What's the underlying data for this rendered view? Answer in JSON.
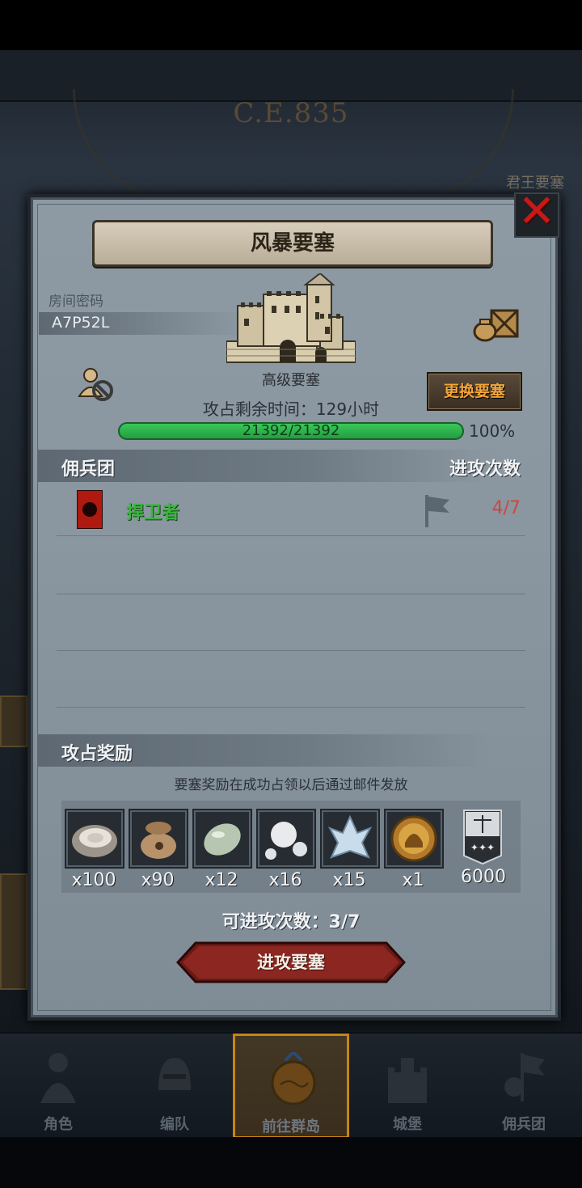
{
  "background": {
    "era_text": "C.E.835",
    "right_title": "君王要塞"
  },
  "dialog": {
    "title": "风暴要塞",
    "room_password_label": "房间密码",
    "room_password": "A7P52L",
    "fortress_type": "高级要塞",
    "time_left": "攻占剩余时间：129小时",
    "change_button": "更换要塞",
    "hp_text": "21392/21392",
    "hp_percent_text": "100%",
    "hp_fraction": 1.0,
    "mercenary_header": "佣兵团",
    "attacks_header": "进攻次数",
    "mercenaries": [
      {
        "name": "捍卫者",
        "attacks": "4/7"
      }
    ],
    "rewards_header": "攻占奖励",
    "rewards_note": "要塞奖励在成功占领以后通过邮件发放",
    "rewards": [
      {
        "icon": "oyster-icon",
        "qty": "x100"
      },
      {
        "icon": "sack-icon",
        "qty": "x90"
      },
      {
        "icon": "jade-stone-icon",
        "qty": "x12"
      },
      {
        "icon": "pearls-icon",
        "qty": "x16"
      },
      {
        "icon": "ice-crystal-icon",
        "qty": "x15"
      },
      {
        "icon": "knight-medal-icon",
        "qty": "x1"
      },
      {
        "icon": "honor-banner-icon",
        "qty": "6000"
      }
    ],
    "attempts_left": "可进攻次数：3/7",
    "attack_button": "进攻要塞"
  },
  "nav": {
    "items": [
      {
        "label": "角色",
        "icon": "knight-icon"
      },
      {
        "label": "编队",
        "icon": "helmet-icon"
      },
      {
        "label": "前往群岛",
        "icon": "island-map-icon",
        "active": true
      },
      {
        "label": "城堡",
        "icon": "castle-icon"
      },
      {
        "label": "佣兵团",
        "icon": "mercenary-icon"
      }
    ]
  },
  "colors": {
    "accent_orange": "#f2a53a",
    "hp_green": "#3ecb5e",
    "attack_red": "#d0463e",
    "merc_green": "#3ab63e",
    "close_red": "#c81818",
    "nav_active": "#c88414"
  }
}
